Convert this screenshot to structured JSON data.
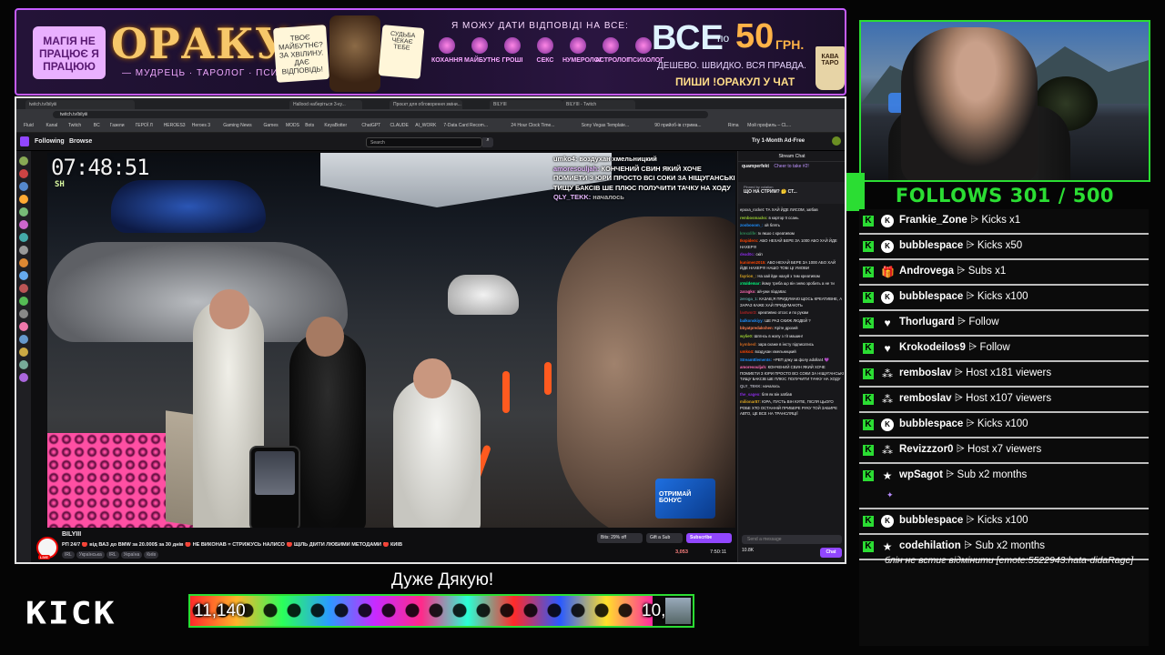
{
  "banner": {
    "left_pill": "МАГІЯ НЕ ПРАЦЮЄ Я ПРАЦЮЮ",
    "title": "ОРАКУЛ",
    "subtitle": "— МУДРЕЦЬ · ТАРОЛОГ · ПСИХОЛОГ —",
    "question": "ТВОЄ МАЙБУТНЄ? ЗА ХВІЛИНУ. ДАЄ ВІДПОВІДЬ!",
    "question2": "СУДЬБА ЧЕКАЄ ТЕБЕ",
    "answers_caption": "Я МОЖУ ДАТИ ВІДПОВІДІ НА ВСЕ:",
    "icons": [
      "КОХАННЯ",
      "МАЙБУТНЄ",
      "ГРОШІ",
      "СЕКС",
      "НУМЕРОЛОГ",
      "АСТРОЛОГ",
      "ПСИХОЛОГ"
    ],
    "vse": "ВСЕ",
    "po": "по",
    "price": "50",
    "currency": "ГРН.",
    "cheap": "ДЕШЕВО. ШВИДКО. ВСЯ ПРАВДА.",
    "write": "ПИШИ !ОРАКУЛ У ЧАТ",
    "cup": "КАВА ТАРО"
  },
  "browser": {
    "tabs": [
      "twitch.tv/bilyiii",
      "Hallood наберіться 3-ку...",
      "Проєкт для обговорення зміни...",
      "BILYIII",
      "BILYIII - Twitch"
    ],
    "url": "twitch.tv/bilyiii",
    "bookmarks": [
      "Fluid",
      "Kanal",
      "Twitch",
      "BC",
      "Газели",
      "ГЕРОЇ Л",
      "HEROES3",
      "Heroes 3",
      "Gaming News",
      "Games",
      "MODS",
      "Bots",
      "KeyaBotter",
      "ChatGPT",
      "CLAUDE",
      "AI_WORK",
      "7-Data Card Recom...",
      "24 Hour Clock Time...",
      "Sony Vegas Template...",
      "90 прийоб-ів стрима...",
      "Rima",
      "Мой профиль – CL..."
    ],
    "nav": {
      "following": "Following",
      "browse": "Browse",
      "search_placeholder": "Search",
      "ad_free": "Try 1-Month Ad-Free"
    }
  },
  "video": {
    "clock": "07:48:51",
    "clock_sub": "SH",
    "overlay_chat": [
      {
        "user": "",
        "text": "umko4: воздухан хмельницкий"
      },
      {
        "user": "amoresouljah:",
        "text": "КОНЧЕНИЙ СВИН ЯКИЙ ХОЧЕ ПОМИЕТИ З ЮРИ ПРОСТО ВСІ СОКИ ЗА НІЩУГАНСЬКІ ТИЩУ БАКСІВ ШЕ ПЛЮС ПОЛУЧИТИ ТАЧКУ НА ХОДУ"
      },
      {
        "user": "QLY_TEKK:",
        "text": "началось"
      }
    ],
    "promo": "ОТРИМАЙ БОНУС"
  },
  "stream": {
    "channel": "BILYIII",
    "live": "LIVE",
    "title": "РП 24/7 🔴 від ВАЗ до BMW за 20.000$ за 30 днів 🔴 НЕ ВИКОНАВ = СТРИЖУСЬ НАЛИСО 🔴 ЩІЛЬ ДІЙТИ ЛЮБИМИ МЕТОДАМИ 🔴 КИЇВ",
    "tags": [
      "IRL",
      "Українська",
      "IRL",
      "Україна",
      "Київ"
    ],
    "bits": "Bits: 29% off",
    "gift": "Gift a Sub",
    "subscribe": "Subscribe",
    "viewers": "3,053",
    "uptime": "7:50:11"
  },
  "twitch_chat": {
    "header": "Stream Chat",
    "top_user": "quamperfekt",
    "cheer": "Cheer to take #2!",
    "pinned_by": "Pinned by volalion",
    "pinned": "ЩО НА СТРИМ? 🤔 СТ...",
    "messages": [
      {
        "user": "",
        "text": "epoxa_rocket: ТА ХАЙ ЙДЕ ЛИСОМ, заїбав",
        "color": "#ff7f50"
      },
      {
        "user": "rembosmacks:",
        "text": "в картор її ссань",
        "color": "#9acd32"
      },
      {
        "user": "zoobooom_:",
        "text": "ой блять",
        "color": "#1e90ff"
      },
      {
        "user": "krexxlife:",
        "text": "Ік якшо с креативом",
        "color": "#2e8b57"
      },
      {
        "user": "Ikspiderx:",
        "text": "АБО НЕХАЙ БЕРЕ ЗА 1000 АБО ХАЙ ЙДЕ НАХЕР!!!",
        "color": "#ff4500"
      },
      {
        "user": "dead0c:",
        "text": "скіп",
        "color": "#8a2be2"
      },
      {
        "user": "kunimen2015:",
        "text": "АБО НЕХАЙ БЕРЕ ЗА 1000 АБО ХАЙ ЙДЕ НАХЕР!!! НАШО ТОБІ ЦІ УМОВИ",
        "color": "#ff4500"
      },
      {
        "user": "fayrion_:",
        "text": "На хай йде нахуй з тим креативом",
        "color": "#daa520"
      },
      {
        "user": "xValdemar:",
        "text": "йому треба що він зняю зробить а не ти",
        "color": "#00ff7f"
      },
      {
        "user": "zaragko:",
        "text": "ай-ужи пізда6ас",
        "color": "#ff69b4"
      },
      {
        "user": "zeroga_1:",
        "text": "КАЗАВ,Я ПРИДУМАЮ ЩОСЬ КРЕАТИВНЕ, А ЗАРАЗ КАЖЕ ХАЙ ПРИДУМАЮТЬ",
        "color": "#5f9ea0"
      },
      {
        "user": "lastwor3:",
        "text": "креативно отсос и по рукам",
        "color": "#b22222"
      },
      {
        "user": "balkonskiyy:",
        "text": "ШЕ РАЗ СКИЖ ЛЮДЕЙ ?",
        "color": "#1e90ff"
      },
      {
        "user": "bbyatpredakshen:",
        "text": "Кріте дрозей",
        "color": "#ff7f50"
      },
      {
        "user": "wylie0:",
        "text": "Шпгнсь в жопу з тії машин!",
        "color": "#9acd32"
      },
      {
        "user": "kymbesl:",
        "text": "зара скаже в інсту підписатись",
        "color": "#d2691e"
      },
      {
        "user": "umko4:",
        "text": "воздухан хмельницкий",
        "color": "#ff4500"
      },
      {
        "user": "StreamElements:",
        "text": "+РЕП дяку за фолу adollar4 💜",
        "color": "#1e90ff"
      },
      {
        "user": "amoresouljah:",
        "text": "КОНЧЕНИЙ СВИН ЯКИЙ ХОЧЕ ПОМИЕТИ З ЮРИ ПРОСТО ВСІ СОКИ ЗА НІЩУГАНСЬКІ ТИЩУ БАКСІВ ШЕ ПЛЮС ПОЛУЧИТИ ТАЧКУ НА ХОДУ",
        "color": "#ff69b4"
      },
      {
        "user": "QLY_TEKK:",
        "text": "началось",
        "color": "#adadb8"
      },
      {
        "user": "the_sageo:",
        "text": "бля як він заїбав",
        "color": "#8a2be2"
      },
      {
        "user": "milionar87:",
        "text": "ЮРА, ПУСТЬ ВІН КУПЕ, ПІСЛЯ ЦЬОГО РОБЕ ХТО ОСТАННІЙ ПРИБЕРЕ РУКУ ТОЙ ЗАБИРЕ АВТО, ЦЕ ВСЕ НА ТРАНСЛЯЦІЇ",
        "color": "#daa520"
      }
    ],
    "input_placeholder": "Send a message",
    "points": "10.8K",
    "chat_btn": "Chat"
  },
  "follows": {
    "label": "FOLLOWS 301 / 500"
  },
  "events": [
    {
      "name": "Frankie_Zone",
      "action": "Kicks x1",
      "icon": "kick-coin-icon"
    },
    {
      "name": "bubblespace",
      "action": "Kicks x50",
      "icon": "kick-coin-icon"
    },
    {
      "name": "Androvega",
      "action": "Subs x1",
      "icon": "gift-icon"
    },
    {
      "name": "bubblespace",
      "action": "Kicks x100",
      "icon": "kick-coin-icon"
    },
    {
      "name": "Thorlugard",
      "action": "Follow",
      "icon": "heart-icon"
    },
    {
      "name": "Krokodeilos9",
      "action": "Follow",
      "icon": "heart-icon"
    },
    {
      "name": "remboslav",
      "action": "Host x181 viewers",
      "icon": "host-icon"
    },
    {
      "name": "remboslav",
      "action": "Host x107 viewers",
      "icon": "host-icon"
    },
    {
      "name": "bubblespace",
      "action": "Kicks x100",
      "icon": "kick-coin-icon"
    },
    {
      "name": "Revizzzor0",
      "action": "Host x7 viewers",
      "icon": "host-icon"
    },
    {
      "name": "wpSagot",
      "action": "Sub x2 months",
      "icon": "star-icon"
    },
    {
      "name": "bubblespace",
      "action": "Kicks x100",
      "icon": "kick-coin-icon"
    },
    {
      "name": "codehilation",
      "action": "Sub x2 months",
      "icon": "star-icon"
    }
  ],
  "event_arrow": "⩥",
  "event_message": "блін не встиг відмінити [emote:5522943:hata-didaRage]",
  "footer": {
    "thanks": "Дуже Дякую!",
    "kick_logo": "KICK",
    "goal_current": "11,140",
    "goal_target": "10,",
    "goal_progress": 0.92
  },
  "colors": {
    "accent_green": "#2bdd33",
    "banner_border": "#c65cff",
    "twitch_purple": "#9147ff"
  }
}
